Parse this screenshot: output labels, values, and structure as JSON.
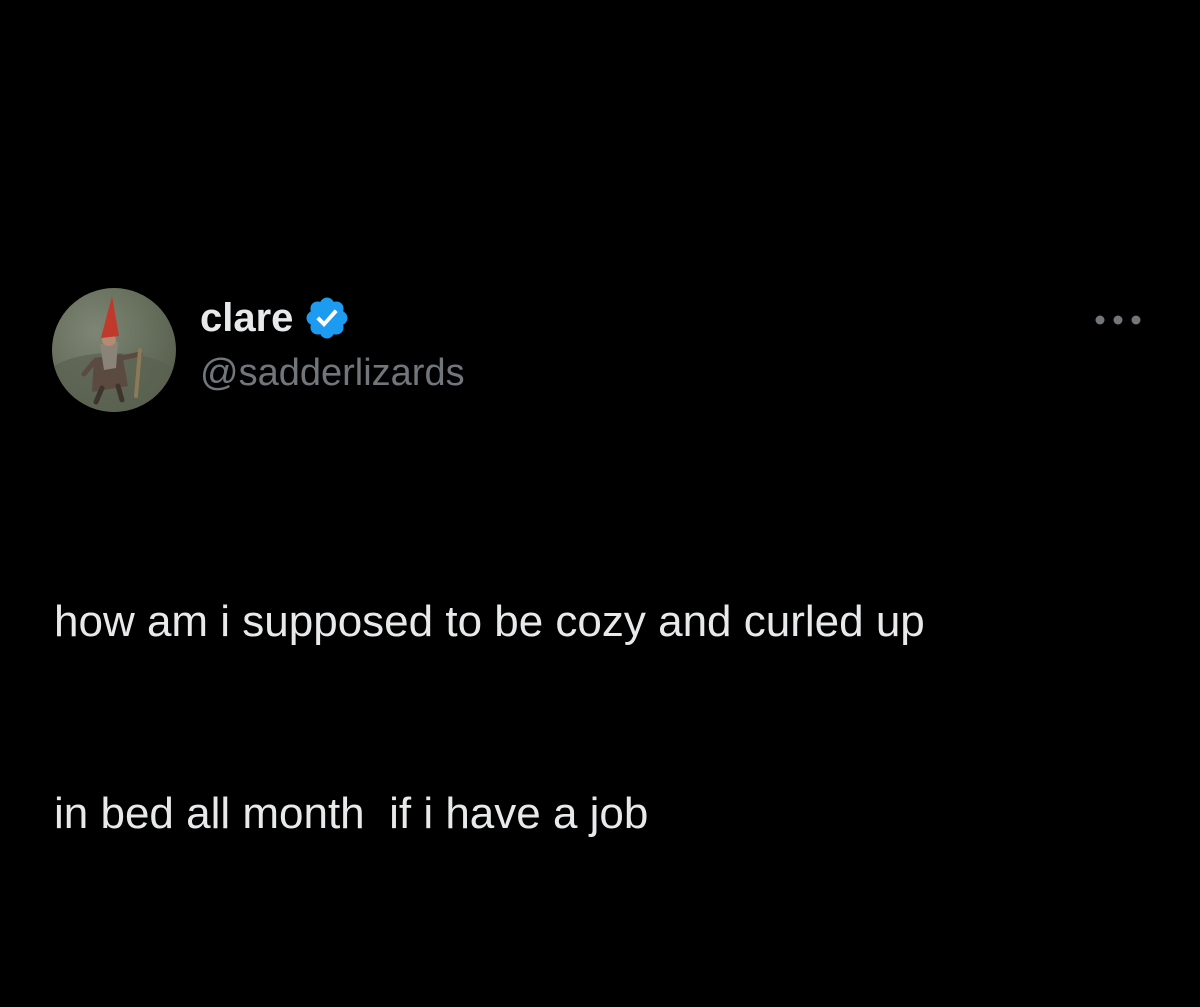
{
  "tweet": {
    "author": {
      "display_name": "clare",
      "handle": "@sadderlizards",
      "verified": true,
      "avatar_icon": "gnome-avatar"
    },
    "text_lines": [
      "how am i supposed to be cozy and curled up",
      "in bed all month  if i have a job"
    ],
    "more_icon": "more-horizontal-icon"
  },
  "colors": {
    "background": "#000000",
    "text_primary": "#e7e9ea",
    "text_secondary": "#71767b",
    "verified_badge": "#1d9bf0"
  }
}
